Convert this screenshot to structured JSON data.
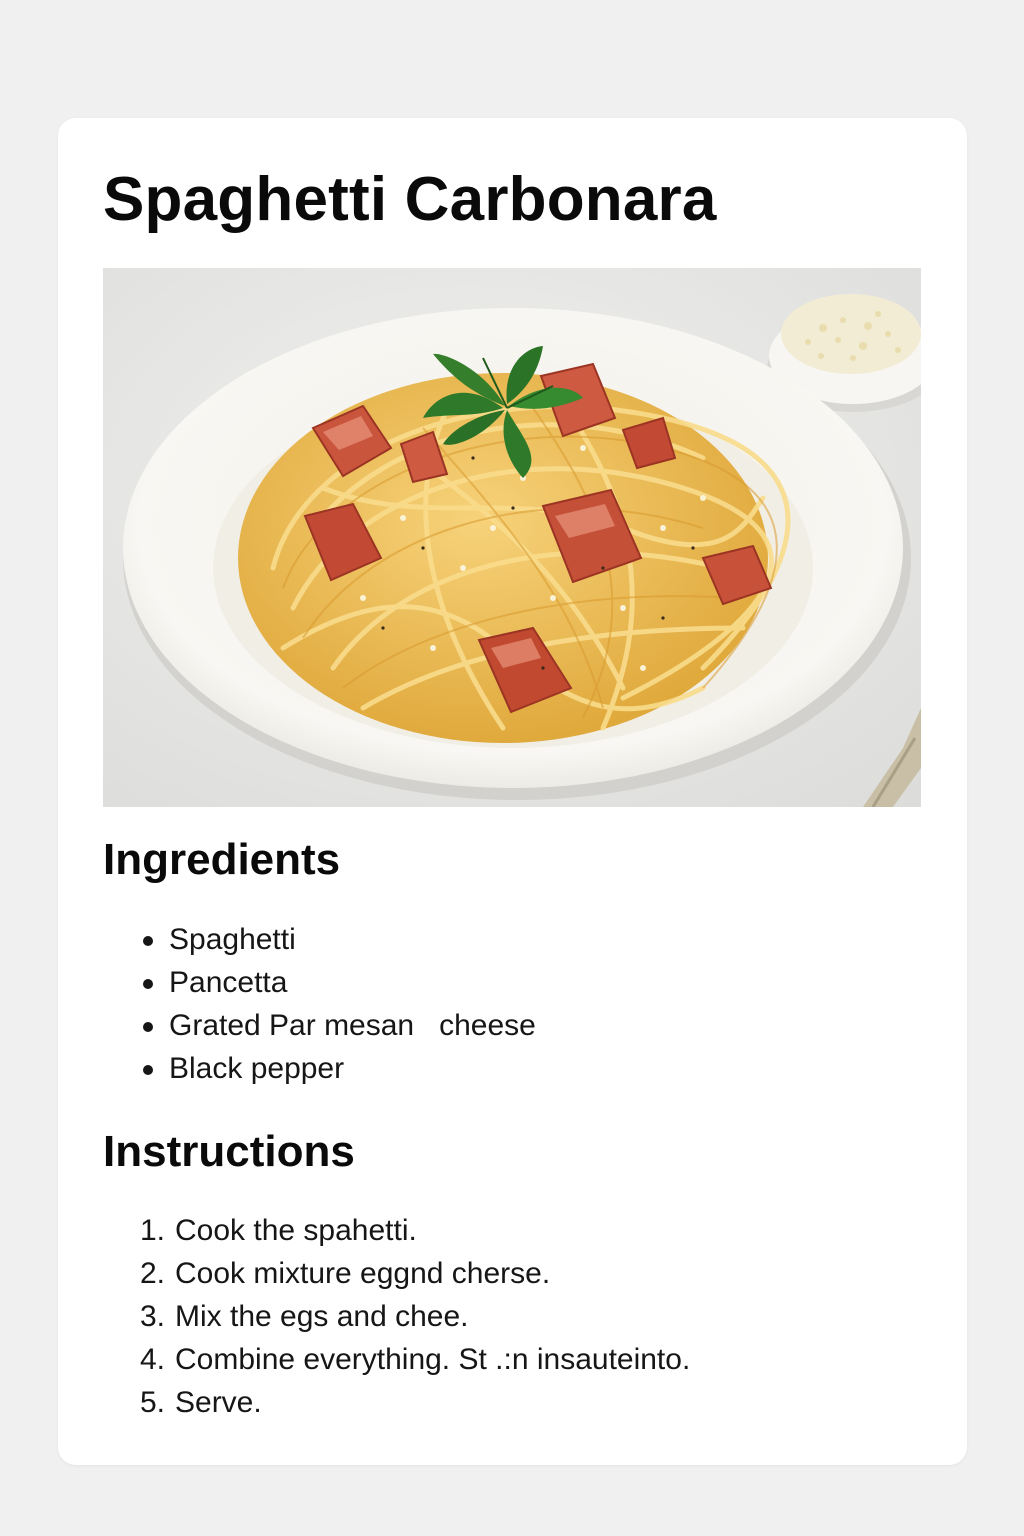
{
  "recipe": {
    "title": "Spaghetti Carbonara",
    "photo_alt": "Spaghetti carbonara with pancetta and parsley in a white bowl",
    "ingredients_heading": "Ingredients",
    "ingredients": [
      "Spaghetti",
      "Pancetta",
      "Grated Par mesan   cheese",
      "Black pepper"
    ],
    "instructions_heading": "Instructions",
    "instructions": [
      {
        "number": "1.",
        "text": "Cook the spahetti."
      },
      {
        "number": "2.",
        "text": "Cook mixture eggnd cherse."
      },
      {
        "number": "3.",
        "text": "Mix the egs and chee."
      },
      {
        "number": "4.",
        "text": "Combine everything. St .:n insauteinto."
      },
      {
        "number": "5.",
        "text": "Serve."
      }
    ]
  },
  "colors": {
    "page_background": "#f0f0f1",
    "card_background": "#ffffff",
    "text": "#111111",
    "pasta": "#f0c45a",
    "pancetta": "#c8503a",
    "parsley": "#2e7a2a",
    "bowl": "#f7f6f3"
  },
  "icons": {
    "list_bullet": "bullet-icon"
  }
}
